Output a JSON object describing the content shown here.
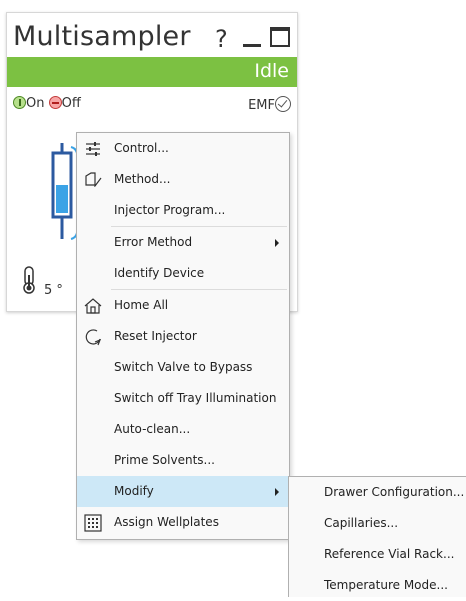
{
  "panel": {
    "title": "Multisampler",
    "help": "?",
    "status": "Idle",
    "status_color": "#7cc142",
    "on_label": "On",
    "off_label": "Off",
    "emf_label": "EMF",
    "temperature": "5 °"
  },
  "context_menu": {
    "items": [
      {
        "label": "Control...",
        "icon": "sliders-icon"
      },
      {
        "label": "Method...",
        "icon": "method-edit-icon"
      },
      {
        "label": "Injector Program..."
      },
      {
        "label": "Error Method",
        "has_submenu": true
      },
      {
        "label": "Identify Device"
      },
      {
        "label": "Home All",
        "icon": "home-icon"
      },
      {
        "label": "Reset Injector",
        "icon": "reset-icon"
      },
      {
        "label": "Switch Valve to Bypass"
      },
      {
        "label": "Switch off Tray Illumination"
      },
      {
        "label": "Auto-clean..."
      },
      {
        "label": "Prime Solvents..."
      },
      {
        "label": "Modify",
        "has_submenu": true,
        "highlighted": true
      },
      {
        "label": "Assign Wellplates",
        "icon": "wellplate-grid-icon"
      }
    ],
    "highlight_color": "#cde8f7"
  },
  "modify_submenu": {
    "items": [
      {
        "label": "Drawer Configuration..."
      },
      {
        "label": "Capillaries..."
      },
      {
        "label": "Reference Vial Rack..."
      },
      {
        "label": "Temperature Mode..."
      }
    ]
  }
}
